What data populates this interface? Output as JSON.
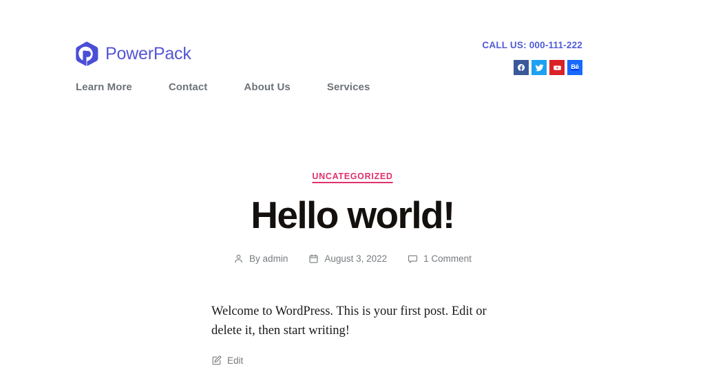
{
  "site": {
    "brand_name": "PowerPack",
    "brand_icon": "powerpack-hexagon-p-logo"
  },
  "header": {
    "nav_items": [
      {
        "label": "Learn More"
      },
      {
        "label": "Contact"
      },
      {
        "label": "About Us"
      },
      {
        "label": "Services"
      }
    ],
    "call_us": "CALL US: 000-111-222",
    "social_links": [
      {
        "name": "facebook",
        "label": "Facebook",
        "color": "#3b5998"
      },
      {
        "name": "twitter",
        "label": "Twitter",
        "color": "#1da1f2"
      },
      {
        "name": "youtube",
        "label": "YouTube",
        "color": "#d92228"
      },
      {
        "name": "behance",
        "label": "Behance",
        "glyph": "Bē",
        "color": "#1769ff"
      }
    ]
  },
  "post": {
    "category": "UNCATEGORIZED",
    "category_color": "#e0316a",
    "title": "Hello world!",
    "meta": {
      "author_icon": "person-icon",
      "author": "By admin",
      "date_icon": "calendar-icon",
      "date": "August 3, 2022",
      "comments_icon": "comment-icon",
      "comments": "1 Comment"
    },
    "content": "Welcome to WordPress. This is your first post. Edit or delete it, then start writing!",
    "edit_label": "Edit",
    "edit_icon": "edit-pencil-icon"
  }
}
